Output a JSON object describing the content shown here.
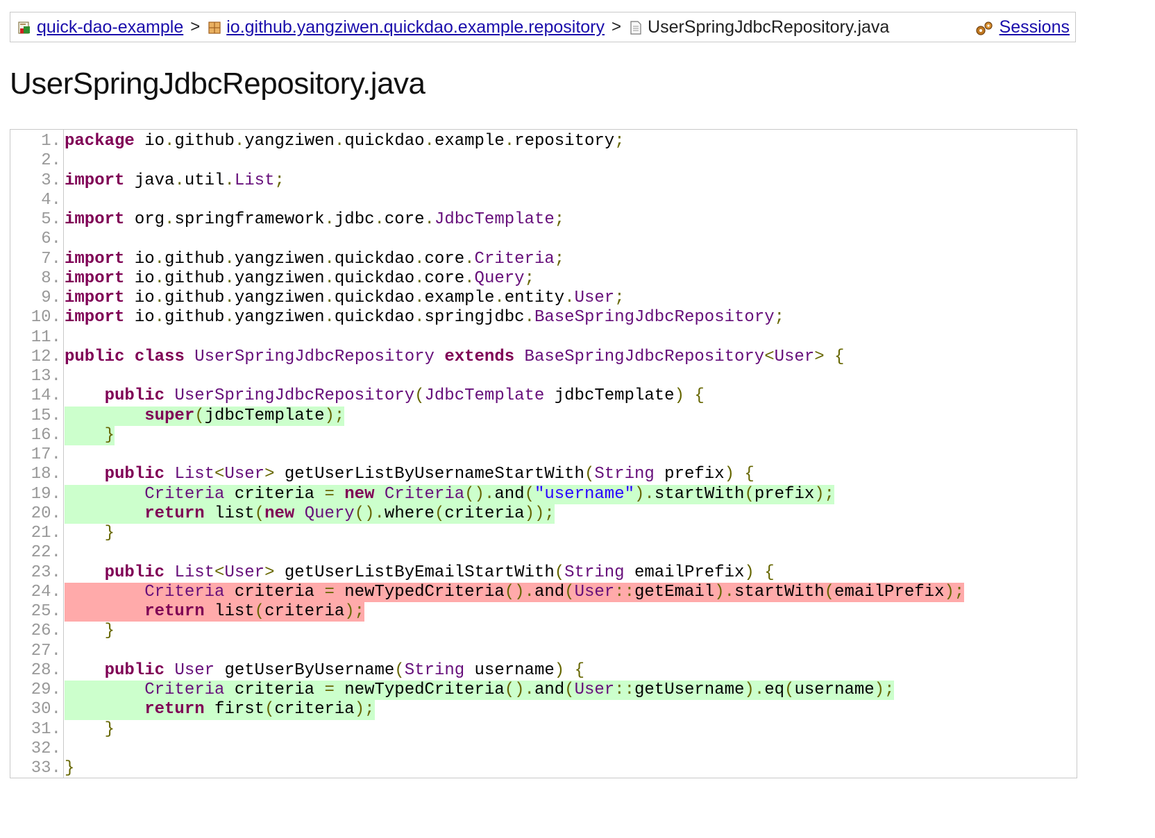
{
  "breadcrumb": {
    "project": "quick-dao-example",
    "package": "io.github.yangziwen.quickdao.example.repository",
    "file": "UserSpringJdbcRepository.java",
    "separator": ">",
    "sessions": "Sessions"
  },
  "icons": {
    "project": "project-report-icon",
    "package": "package-icon",
    "file": "java-file-icon",
    "sessions": "sessions-gears-icon"
  },
  "title": "UserSpringJdbcRepository.java",
  "colors": {
    "covered": "#ccffcc",
    "not_covered": "#ffaaaa",
    "keyword": "#7f0055",
    "type": "#660e7a",
    "punctuation": "#666600",
    "string": "#2a00ff",
    "link": "#1a0dab"
  },
  "code": {
    "lines": [
      {
        "n": "1.",
        "hl": "",
        "tokens": [
          [
            "kw",
            "package"
          ],
          [
            "pln",
            " io"
          ],
          [
            "pun",
            "."
          ],
          [
            "pln",
            "github"
          ],
          [
            "pun",
            "."
          ],
          [
            "pln",
            "yangziwen"
          ],
          [
            "pun",
            "."
          ],
          [
            "pln",
            "quickdao"
          ],
          [
            "pun",
            "."
          ],
          [
            "pln",
            "example"
          ],
          [
            "pun",
            "."
          ],
          [
            "pln",
            "repository"
          ],
          [
            "pun",
            ";"
          ]
        ]
      },
      {
        "n": "2.",
        "hl": "",
        "tokens": []
      },
      {
        "n": "3.",
        "hl": "",
        "tokens": [
          [
            "kw",
            "import"
          ],
          [
            "pln",
            " java"
          ],
          [
            "pun",
            "."
          ],
          [
            "pln",
            "util"
          ],
          [
            "pun",
            "."
          ],
          [
            "typ",
            "List"
          ],
          [
            "pun",
            ";"
          ]
        ]
      },
      {
        "n": "4.",
        "hl": "",
        "tokens": []
      },
      {
        "n": "5.",
        "hl": "",
        "tokens": [
          [
            "kw",
            "import"
          ],
          [
            "pln",
            " org"
          ],
          [
            "pun",
            "."
          ],
          [
            "pln",
            "springframework"
          ],
          [
            "pun",
            "."
          ],
          [
            "pln",
            "jdbc"
          ],
          [
            "pun",
            "."
          ],
          [
            "pln",
            "core"
          ],
          [
            "pun",
            "."
          ],
          [
            "typ",
            "JdbcTemplate"
          ],
          [
            "pun",
            ";"
          ]
        ]
      },
      {
        "n": "6.",
        "hl": "",
        "tokens": []
      },
      {
        "n": "7.",
        "hl": "",
        "tokens": [
          [
            "kw",
            "import"
          ],
          [
            "pln",
            " io"
          ],
          [
            "pun",
            "."
          ],
          [
            "pln",
            "github"
          ],
          [
            "pun",
            "."
          ],
          [
            "pln",
            "yangziwen"
          ],
          [
            "pun",
            "."
          ],
          [
            "pln",
            "quickdao"
          ],
          [
            "pun",
            "."
          ],
          [
            "pln",
            "core"
          ],
          [
            "pun",
            "."
          ],
          [
            "typ",
            "Criteria"
          ],
          [
            "pun",
            ";"
          ]
        ]
      },
      {
        "n": "8.",
        "hl": "",
        "tokens": [
          [
            "kw",
            "import"
          ],
          [
            "pln",
            " io"
          ],
          [
            "pun",
            "."
          ],
          [
            "pln",
            "github"
          ],
          [
            "pun",
            "."
          ],
          [
            "pln",
            "yangziwen"
          ],
          [
            "pun",
            "."
          ],
          [
            "pln",
            "quickdao"
          ],
          [
            "pun",
            "."
          ],
          [
            "pln",
            "core"
          ],
          [
            "pun",
            "."
          ],
          [
            "typ",
            "Query"
          ],
          [
            "pun",
            ";"
          ]
        ]
      },
      {
        "n": "9.",
        "hl": "",
        "tokens": [
          [
            "kw",
            "import"
          ],
          [
            "pln",
            " io"
          ],
          [
            "pun",
            "."
          ],
          [
            "pln",
            "github"
          ],
          [
            "pun",
            "."
          ],
          [
            "pln",
            "yangziwen"
          ],
          [
            "pun",
            "."
          ],
          [
            "pln",
            "quickdao"
          ],
          [
            "pun",
            "."
          ],
          [
            "pln",
            "example"
          ],
          [
            "pun",
            "."
          ],
          [
            "pln",
            "entity"
          ],
          [
            "pun",
            "."
          ],
          [
            "typ",
            "User"
          ],
          [
            "pun",
            ";"
          ]
        ]
      },
      {
        "n": "10.",
        "hl": "",
        "tokens": [
          [
            "kw",
            "import"
          ],
          [
            "pln",
            " io"
          ],
          [
            "pun",
            "."
          ],
          [
            "pln",
            "github"
          ],
          [
            "pun",
            "."
          ],
          [
            "pln",
            "yangziwen"
          ],
          [
            "pun",
            "."
          ],
          [
            "pln",
            "quickdao"
          ],
          [
            "pun",
            "."
          ],
          [
            "pln",
            "springjdbc"
          ],
          [
            "pun",
            "."
          ],
          [
            "typ",
            "BaseSpringJdbcRepository"
          ],
          [
            "pun",
            ";"
          ]
        ]
      },
      {
        "n": "11.",
        "hl": "",
        "tokens": []
      },
      {
        "n": "12.",
        "hl": "",
        "tokens": [
          [
            "kw",
            "public"
          ],
          [
            "pln",
            " "
          ],
          [
            "kw",
            "class"
          ],
          [
            "pln",
            " "
          ],
          [
            "typ",
            "UserSpringJdbcRepository"
          ],
          [
            "pln",
            " "
          ],
          [
            "kw",
            "extends"
          ],
          [
            "pln",
            " "
          ],
          [
            "typ",
            "BaseSpringJdbcRepository"
          ],
          [
            "pun",
            "<"
          ],
          [
            "typ",
            "User"
          ],
          [
            "pun",
            ">"
          ],
          [
            "pln",
            " "
          ],
          [
            "pun",
            "{"
          ]
        ]
      },
      {
        "n": "13.",
        "hl": "",
        "tokens": []
      },
      {
        "n": "14.",
        "hl": "",
        "tokens": [
          [
            "pln",
            "    "
          ],
          [
            "kw",
            "public"
          ],
          [
            "pln",
            " "
          ],
          [
            "typ",
            "UserSpringJdbcRepository"
          ],
          [
            "pun",
            "("
          ],
          [
            "typ",
            "JdbcTemplate"
          ],
          [
            "pln",
            " jdbcTemplate"
          ],
          [
            "pun",
            ")"
          ],
          [
            "pln",
            " "
          ],
          [
            "pun",
            "{"
          ]
        ]
      },
      {
        "n": "15.",
        "hl": "green",
        "tokens": [
          [
            "pln",
            "        "
          ],
          [
            "kw",
            "super"
          ],
          [
            "pun",
            "("
          ],
          [
            "pln",
            "jdbcTemplate"
          ],
          [
            "pun",
            ");"
          ]
        ]
      },
      {
        "n": "16.",
        "hl": "green",
        "tokens": [
          [
            "pln",
            "    "
          ],
          [
            "pun",
            "}"
          ]
        ]
      },
      {
        "n": "17.",
        "hl": "",
        "tokens": []
      },
      {
        "n": "18.",
        "hl": "",
        "tokens": [
          [
            "pln",
            "    "
          ],
          [
            "kw",
            "public"
          ],
          [
            "pln",
            " "
          ],
          [
            "typ",
            "List"
          ],
          [
            "pun",
            "<"
          ],
          [
            "typ",
            "User"
          ],
          [
            "pun",
            ">"
          ],
          [
            "pln",
            " getUserListByUsernameStartWith"
          ],
          [
            "pun",
            "("
          ],
          [
            "typ",
            "String"
          ],
          [
            "pln",
            " prefix"
          ],
          [
            "pun",
            ")"
          ],
          [
            "pln",
            " "
          ],
          [
            "pun",
            "{"
          ]
        ]
      },
      {
        "n": "19.",
        "hl": "green",
        "tokens": [
          [
            "pln",
            "        "
          ],
          [
            "typ",
            "Criteria"
          ],
          [
            "pln",
            " criteria "
          ],
          [
            "pun",
            "="
          ],
          [
            "pln",
            " "
          ],
          [
            "kw",
            "new"
          ],
          [
            "pln",
            " "
          ],
          [
            "typ",
            "Criteria"
          ],
          [
            "pun",
            "()."
          ],
          [
            "pln",
            "and"
          ],
          [
            "pun",
            "("
          ],
          [
            "str",
            "\"username\""
          ],
          [
            "pun",
            ")."
          ],
          [
            "pln",
            "startWith"
          ],
          [
            "pun",
            "("
          ],
          [
            "pln",
            "prefix"
          ],
          [
            "pun",
            ");"
          ]
        ]
      },
      {
        "n": "20.",
        "hl": "green",
        "tokens": [
          [
            "pln",
            "        "
          ],
          [
            "kw",
            "return"
          ],
          [
            "pln",
            " list"
          ],
          [
            "pun",
            "("
          ],
          [
            "kw",
            "new"
          ],
          [
            "pln",
            " "
          ],
          [
            "typ",
            "Query"
          ],
          [
            "pun",
            "()."
          ],
          [
            "pln",
            "where"
          ],
          [
            "pun",
            "("
          ],
          [
            "pln",
            "criteria"
          ],
          [
            "pun",
            "));"
          ]
        ]
      },
      {
        "n": "21.",
        "hl": "",
        "tokens": [
          [
            "pln",
            "    "
          ],
          [
            "pun",
            "}"
          ]
        ]
      },
      {
        "n": "22.",
        "hl": "",
        "tokens": []
      },
      {
        "n": "23.",
        "hl": "",
        "tokens": [
          [
            "pln",
            "    "
          ],
          [
            "kw",
            "public"
          ],
          [
            "pln",
            " "
          ],
          [
            "typ",
            "List"
          ],
          [
            "pun",
            "<"
          ],
          [
            "typ",
            "User"
          ],
          [
            "pun",
            ">"
          ],
          [
            "pln",
            " getUserListByEmailStartWith"
          ],
          [
            "pun",
            "("
          ],
          [
            "typ",
            "String"
          ],
          [
            "pln",
            " emailPrefix"
          ],
          [
            "pun",
            ")"
          ],
          [
            "pln",
            " "
          ],
          [
            "pun",
            "{"
          ]
        ]
      },
      {
        "n": "24.",
        "hl": "red",
        "tokens": [
          [
            "pln",
            "        "
          ],
          [
            "typ",
            "Criteria"
          ],
          [
            "pln",
            " criteria "
          ],
          [
            "pun",
            "="
          ],
          [
            "pln",
            " newTypedCriteria"
          ],
          [
            "pun",
            "()."
          ],
          [
            "pln",
            "and"
          ],
          [
            "pun",
            "("
          ],
          [
            "typ",
            "User"
          ],
          [
            "pun",
            "::"
          ],
          [
            "pln",
            "getEmail"
          ],
          [
            "pun",
            ")."
          ],
          [
            "pln",
            "startWith"
          ],
          [
            "pun",
            "("
          ],
          [
            "pln",
            "emailPrefix"
          ],
          [
            "pun",
            ");"
          ]
        ]
      },
      {
        "n": "25.",
        "hl": "red",
        "tokens": [
          [
            "pln",
            "        "
          ],
          [
            "kw",
            "return"
          ],
          [
            "pln",
            " list"
          ],
          [
            "pun",
            "("
          ],
          [
            "pln",
            "criteria"
          ],
          [
            "pun",
            ");"
          ]
        ]
      },
      {
        "n": "26.",
        "hl": "",
        "tokens": [
          [
            "pln",
            "    "
          ],
          [
            "pun",
            "}"
          ]
        ]
      },
      {
        "n": "27.",
        "hl": "",
        "tokens": []
      },
      {
        "n": "28.",
        "hl": "",
        "tokens": [
          [
            "pln",
            "    "
          ],
          [
            "kw",
            "public"
          ],
          [
            "pln",
            " "
          ],
          [
            "typ",
            "User"
          ],
          [
            "pln",
            " getUserByUsername"
          ],
          [
            "pun",
            "("
          ],
          [
            "typ",
            "String"
          ],
          [
            "pln",
            " username"
          ],
          [
            "pun",
            ")"
          ],
          [
            "pln",
            " "
          ],
          [
            "pun",
            "{"
          ]
        ]
      },
      {
        "n": "29.",
        "hl": "green",
        "tokens": [
          [
            "pln",
            "        "
          ],
          [
            "typ",
            "Criteria"
          ],
          [
            "pln",
            " criteria "
          ],
          [
            "pun",
            "="
          ],
          [
            "pln",
            " newTypedCriteria"
          ],
          [
            "pun",
            "()."
          ],
          [
            "pln",
            "and"
          ],
          [
            "pun",
            "("
          ],
          [
            "typ",
            "User"
          ],
          [
            "pun",
            "::"
          ],
          [
            "pln",
            "getUsername"
          ],
          [
            "pun",
            ")."
          ],
          [
            "pln",
            "eq"
          ],
          [
            "pun",
            "("
          ],
          [
            "pln",
            "username"
          ],
          [
            "pun",
            ");"
          ]
        ]
      },
      {
        "n": "30.",
        "hl": "green",
        "tokens": [
          [
            "pln",
            "        "
          ],
          [
            "kw",
            "return"
          ],
          [
            "pln",
            " first"
          ],
          [
            "pun",
            "("
          ],
          [
            "pln",
            "criteria"
          ],
          [
            "pun",
            ");"
          ]
        ]
      },
      {
        "n": "31.",
        "hl": "",
        "tokens": [
          [
            "pln",
            "    "
          ],
          [
            "pun",
            "}"
          ]
        ]
      },
      {
        "n": "32.",
        "hl": "",
        "tokens": []
      },
      {
        "n": "33.",
        "hl": "",
        "tokens": [
          [
            "pun",
            "}"
          ]
        ]
      }
    ]
  }
}
